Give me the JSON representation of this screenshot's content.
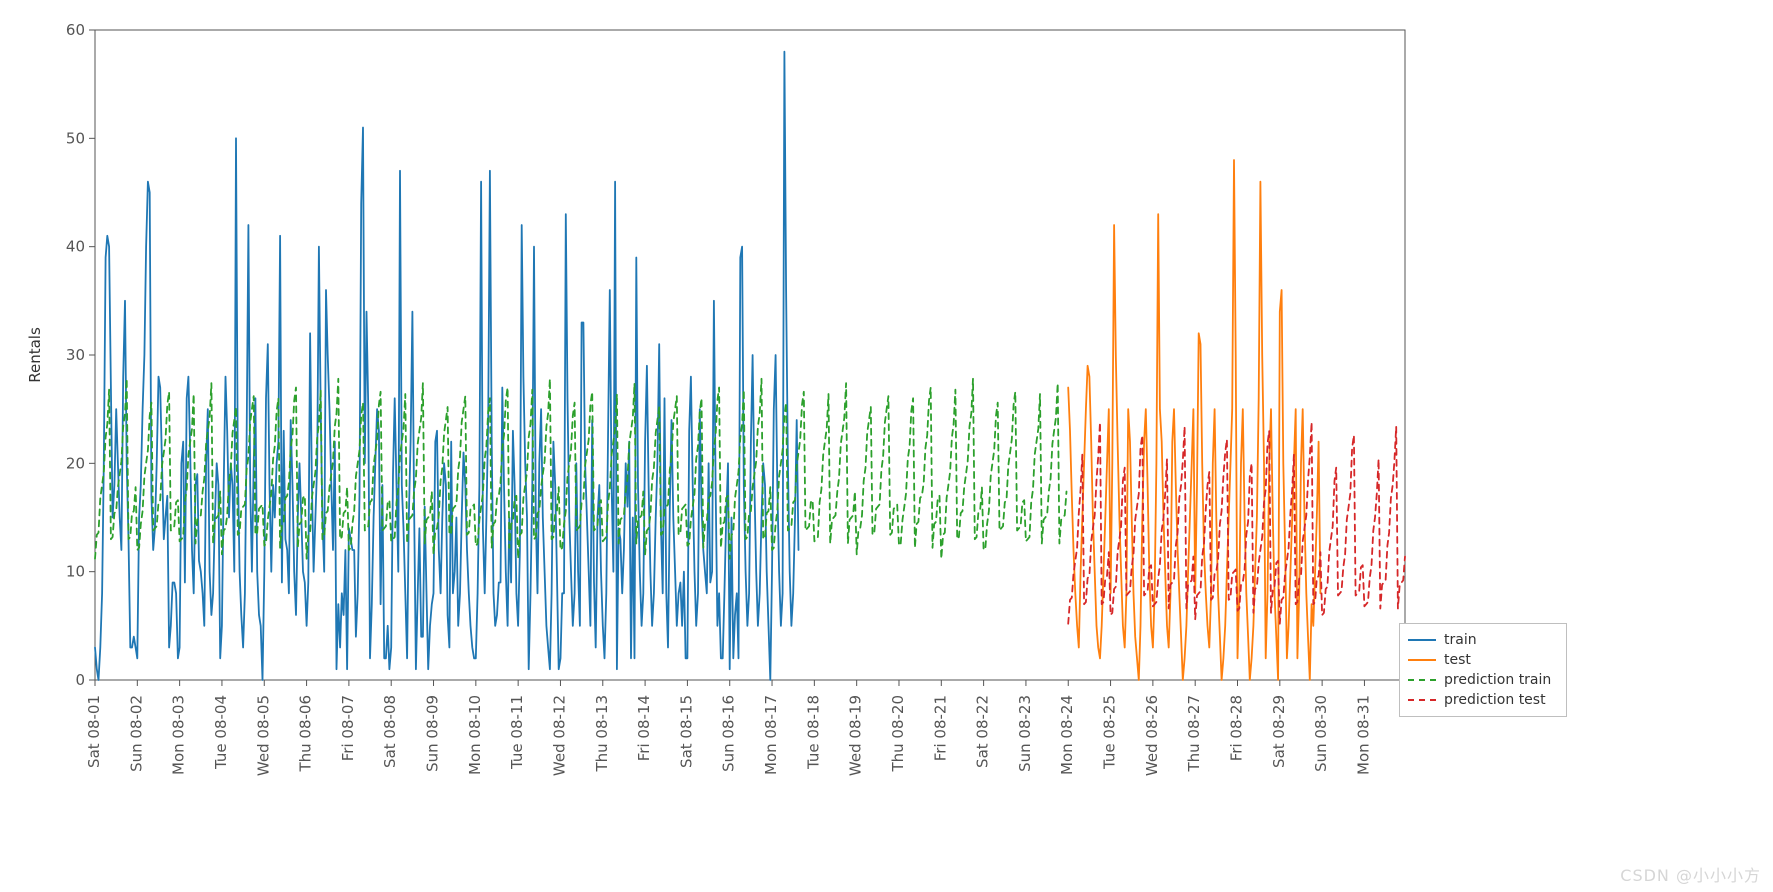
{
  "chart_data": {
    "type": "line",
    "ylabel": "Rentals",
    "xlabel": "",
    "ylim": [
      0,
      60
    ],
    "yticks": [
      0,
      10,
      20,
      30,
      40,
      50,
      60
    ],
    "categories": [
      "Sat 08-01",
      "Sun 08-02",
      "Mon 08-03",
      "Tue 08-04",
      "Wed 08-05",
      "Thu 08-06",
      "Fri 08-07",
      "Sat 08-08",
      "Sun 08-09",
      "Mon 08-10",
      "Tue 08-11",
      "Wed 08-12",
      "Thu 08-13",
      "Fri 08-14",
      "Sat 08-15",
      "Sun 08-16",
      "Mon 08-17",
      "Tue 08-18",
      "Wed 08-19",
      "Thu 08-20",
      "Fri 08-21",
      "Sat 08-22",
      "Sun 08-23",
      "Mon 08-24",
      "Tue 08-25",
      "Wed 08-26",
      "Thu 08-27",
      "Fri 08-28",
      "Sat 08-29",
      "Sun 08-30",
      "Mon 08-31"
    ],
    "hours_per_day": 24,
    "series": [
      {
        "name": "train",
        "color": "#1f77b4",
        "style": "solid",
        "day_start": 0,
        "day_end": 23,
        "values": [
          3,
          1,
          0,
          3,
          8,
          20,
          39,
          41,
          40,
          27,
          15,
          18,
          25,
          20,
          15,
          12,
          28,
          35,
          20,
          13,
          3,
          3,
          4,
          3,
          2,
          15,
          18,
          25,
          30,
          40,
          46,
          45,
          17,
          12,
          14,
          20,
          28,
          27,
          20,
          13,
          15,
          17,
          3,
          5,
          9,
          9,
          8,
          2,
          3,
          20,
          22,
          9,
          26,
          28,
          21,
          12,
          8,
          18,
          19,
          11,
          10,
          8,
          5,
          20,
          25,
          10,
          6,
          8,
          15,
          20,
          18,
          2,
          5,
          18,
          28,
          23,
          15,
          20,
          18,
          10,
          50,
          20,
          10,
          6,
          3,
          8,
          22,
          42,
          18,
          10,
          20,
          26,
          10,
          6,
          5,
          0,
          10,
          26,
          31,
          18,
          10,
          18,
          15,
          20,
          22,
          41,
          9,
          23,
          13,
          12,
          8,
          24,
          18,
          10,
          6,
          15,
          20,
          15,
          10,
          9,
          5,
          9,
          32,
          18,
          10,
          15,
          20,
          40,
          25,
          15,
          10,
          36,
          30,
          25,
          18,
          12,
          22,
          1,
          7,
          3,
          8,
          6,
          12,
          1,
          14,
          13,
          12,
          12,
          4,
          8,
          17,
          44,
          51,
          20,
          34,
          25,
          2,
          7,
          15,
          20,
          25,
          23,
          7,
          18,
          2,
          2,
          5,
          1,
          3,
          19,
          26,
          18,
          10,
          47,
          18,
          14,
          8,
          2,
          15,
          22,
          34,
          16,
          1,
          8,
          14,
          4,
          4,
          16,
          8,
          1,
          5,
          7,
          8,
          22,
          23,
          12,
          8,
          15,
          20,
          18,
          6,
          3,
          22,
          8,
          10,
          15,
          5,
          8,
          15,
          21,
          18,
          12,
          8,
          5,
          3,
          2,
          2,
          8,
          18,
          46,
          14,
          8,
          15,
          24,
          47,
          22,
          8,
          5,
          6,
          9,
          9,
          27,
          18,
          10,
          5,
          15,
          9,
          23,
          18,
          8,
          5,
          12,
          42,
          28,
          20,
          15,
          1,
          8,
          18,
          40,
          15,
          8,
          20,
          25,
          15,
          10,
          5,
          3,
          1,
          8,
          22,
          18,
          10,
          1,
          2,
          8,
          8,
          43,
          26,
          15,
          10,
          5,
          8,
          20,
          10,
          5,
          33,
          33,
          20,
          15,
          10,
          5,
          24,
          9,
          3,
          15,
          18,
          10,
          5,
          2,
          8,
          23,
          36,
          18,
          10,
          46,
          1,
          14,
          13,
          8,
          12,
          20,
          16,
          22,
          2,
          15,
          2,
          39,
          18,
          10,
          5,
          8,
          22,
          29,
          18,
          10,
          5,
          8,
          15,
          20,
          31,
          14,
          8,
          26,
          8,
          3,
          16,
          24,
          15,
          10,
          5,
          8,
          9,
          5,
          10,
          2,
          2,
          23,
          28,
          18,
          10,
          5,
          8,
          25,
          16,
          12,
          10,
          8,
          20,
          9,
          10,
          35,
          18,
          5,
          8,
          2,
          2,
          8,
          15,
          20,
          1,
          15,
          2,
          6,
          8,
          2,
          39,
          40,
          18,
          10,
          5,
          8,
          22,
          30,
          18,
          10,
          5,
          8,
          15,
          20,
          18,
          10,
          5,
          0,
          10,
          25,
          30,
          18,
          10,
          5,
          8,
          58,
          36,
          20,
          10,
          5,
          8,
          15,
          24,
          12
        ],
        "note": "Hourly values over days 08-01 to 08-23 (approximate, read from chart)."
      },
      {
        "name": "test",
        "color": "#ff7f0e",
        "style": "solid",
        "day_start": 23,
        "day_end": 31,
        "values": [
          27,
          23,
          17,
          12,
          8,
          5,
          3,
          10,
          15,
          20,
          25,
          29,
          28,
          22,
          15,
          10,
          5,
          3,
          2,
          5,
          10,
          15,
          20,
          25,
          8,
          20,
          42,
          30,
          22,
          15,
          10,
          5,
          3,
          8,
          25,
          22,
          15,
          8,
          4,
          2,
          0,
          5,
          15,
          22,
          25,
          18,
          10,
          5,
          3,
          8,
          20,
          43,
          25,
          22,
          15,
          10,
          5,
          3,
          8,
          22,
          25,
          18,
          12,
          8,
          4,
          0,
          2,
          5,
          10,
          15,
          20,
          25,
          8,
          18,
          32,
          31,
          20,
          12,
          8,
          5,
          3,
          8,
          20,
          25,
          15,
          8,
          4,
          0,
          2,
          5,
          10,
          15,
          20,
          25,
          48,
          30,
          2,
          8,
          20,
          25,
          15,
          8,
          4,
          0,
          2,
          5,
          10,
          15,
          26,
          46,
          30,
          20,
          2,
          8,
          20,
          25,
          15,
          8,
          4,
          0,
          34,
          36,
          20,
          12,
          2,
          5,
          10,
          15,
          20,
          25,
          2,
          8,
          20,
          25,
          15,
          8,
          4,
          0,
          7,
          5,
          10,
          15,
          22,
          8
        ],
        "note": "Hourly values over days 08-24 to 08-31 (approximate, read from chart)."
      },
      {
        "name": "prediction train",
        "color": "#2ca02c",
        "style": "dashed",
        "day_start": 0,
        "day_end": 23,
        "pattern_per_day": [
          12,
          13,
          14,
          16,
          18,
          20,
          22,
          24,
          26,
          13,
          14,
          15,
          16,
          17,
          19,
          21,
          23,
          25,
          27,
          13,
          14,
          15,
          16,
          17
        ],
        "note": "Repeating sawtooth-like daily pattern, approx range 12–27."
      },
      {
        "name": "prediction test",
        "color": "#d62728",
        "style": "dashed",
        "day_start": 23,
        "day_end": 31,
        "pattern_per_day": [
          6,
          7,
          8,
          9,
          11,
          13,
          15,
          18,
          20,
          7,
          8,
          9,
          10,
          12,
          14,
          16,
          18,
          21,
          23,
          7,
          8,
          9,
          10,
          11
        ],
        "note": "Repeating sawtooth-like daily pattern, approx range 6–23."
      }
    ]
  },
  "legend": {
    "items": [
      "train",
      "test",
      "prediction train",
      "prediction test"
    ]
  },
  "watermark": "CSDN @小小小方"
}
